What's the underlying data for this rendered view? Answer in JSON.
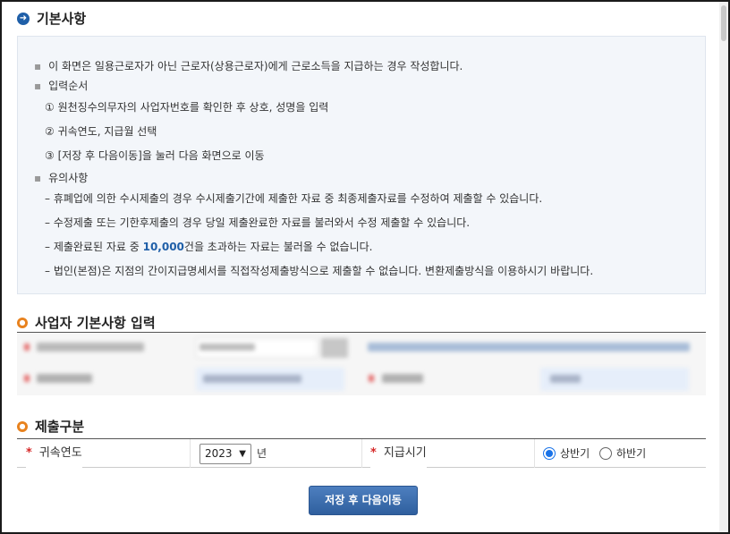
{
  "basic": {
    "title": "기본사항",
    "line1": "이 화면은 일용근로자가 아닌 근로자(상용근로자)에게 근로소득을 지급하는 경우 작성합니다.",
    "order_title": "입력순서",
    "step1": "①  원천징수의무자의 사업자번호를 확인한 후 상호, 성명을 입력",
    "step2": "②  귀속연도, 지급월 선택",
    "step3": "③  [저장 후 다음이동]을 눌러 다음 화면으로 이동",
    "note_title": "유의사항",
    "note1": "– 휴폐업에 의한 수시제출의 경우 수시제출기간에 제출한 자료 중 최종제출자료를 수정하여 제출할 수 있습니다.",
    "note2": "– 수정제출 또는 기한후제출의 경우 당일 제출완료한 자료를 불러와서 수정 제출할 수 있습니다.",
    "note3_pre": "– 제출완료된 자료 중 ",
    "note3_hl": "10,000",
    "note3_post": "건을 초과하는 자료는 불러올 수 없습니다.",
    "note4": "– 법인(본점)은 지점의 간이지급명세서를 직접작성제출방식으로 제출할 수 없습니다. 변환제출방식을 이용하시기 바랍니다."
  },
  "business": {
    "title": "사업자 기본사항 입력"
  },
  "submission": {
    "title": "제출구분",
    "year_label": "귀속연도",
    "year_value": "2023",
    "year_unit": "년",
    "period_label": "지급시기",
    "option1": "상반기",
    "option2": "하반기",
    "selected": "상반기"
  },
  "actions": {
    "save_next": "저장 후 다음이동"
  },
  "colors": {
    "accent": "#1f5fa8",
    "section_icon": "#e8821e",
    "required": "#d62828",
    "radio": "#1a73e8"
  }
}
